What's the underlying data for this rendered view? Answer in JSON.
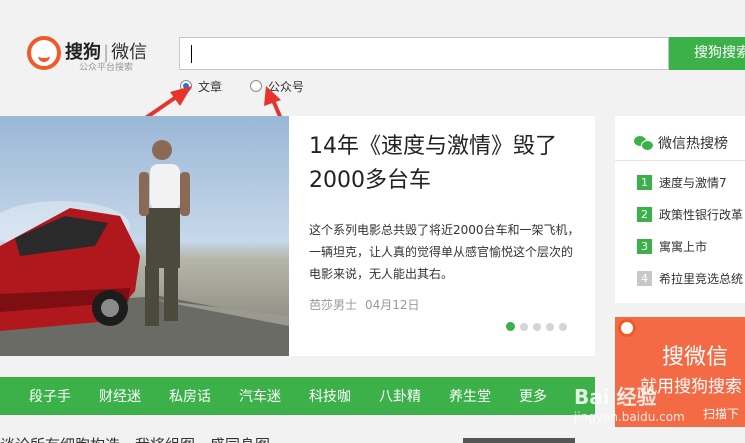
{
  "brand": {
    "name": "搜狗",
    "divider": "|",
    "product": "微信",
    "subtitle": "公众平台搜索"
  },
  "search": {
    "value": "",
    "button_label": "搜狗搜索",
    "types": [
      {
        "label": "文章",
        "checked": true
      },
      {
        "label": "公众号",
        "checked": false
      }
    ]
  },
  "feature": {
    "title": "14年《速度与激情》毁了2000多台车",
    "description": "这个系列电影总共毁了将近2000台车和一架飞机，一辆坦克，让人真的觉得单从感官愉悦这个层次的电影来说，无人能出其右。",
    "author": "芭莎男士",
    "date": "04月12日",
    "slides": 5,
    "active_slide": 1
  },
  "hot": {
    "title": "微信热搜榜",
    "items": [
      {
        "rank": "1",
        "label": "速度与激情7"
      },
      {
        "rank": "2",
        "label": "政策性银行改革"
      },
      {
        "rank": "3",
        "label": "寓寓上市"
      },
      {
        "rank": "4",
        "label": "希拉里竞选总统"
      }
    ]
  },
  "ad": {
    "title": "搜微信",
    "subtitle": "就用搜狗搜索",
    "scan": "扫描下"
  },
  "nav": {
    "items": [
      "段子手",
      "财经迷",
      "私房话",
      "汽车迷",
      "科技咖",
      "八卦精",
      "养生堂",
      "更多"
    ]
  },
  "below": {
    "text": "谈论所有细胞构造，我将组图，盛同身图"
  },
  "watermark": {
    "brand": "Bai 经验",
    "url": "jingyan.baidu.com"
  },
  "colors": {
    "brand_green": "#3cb14a",
    "logo_orange": "#f05a28",
    "annotation_red": "#e8322c"
  }
}
